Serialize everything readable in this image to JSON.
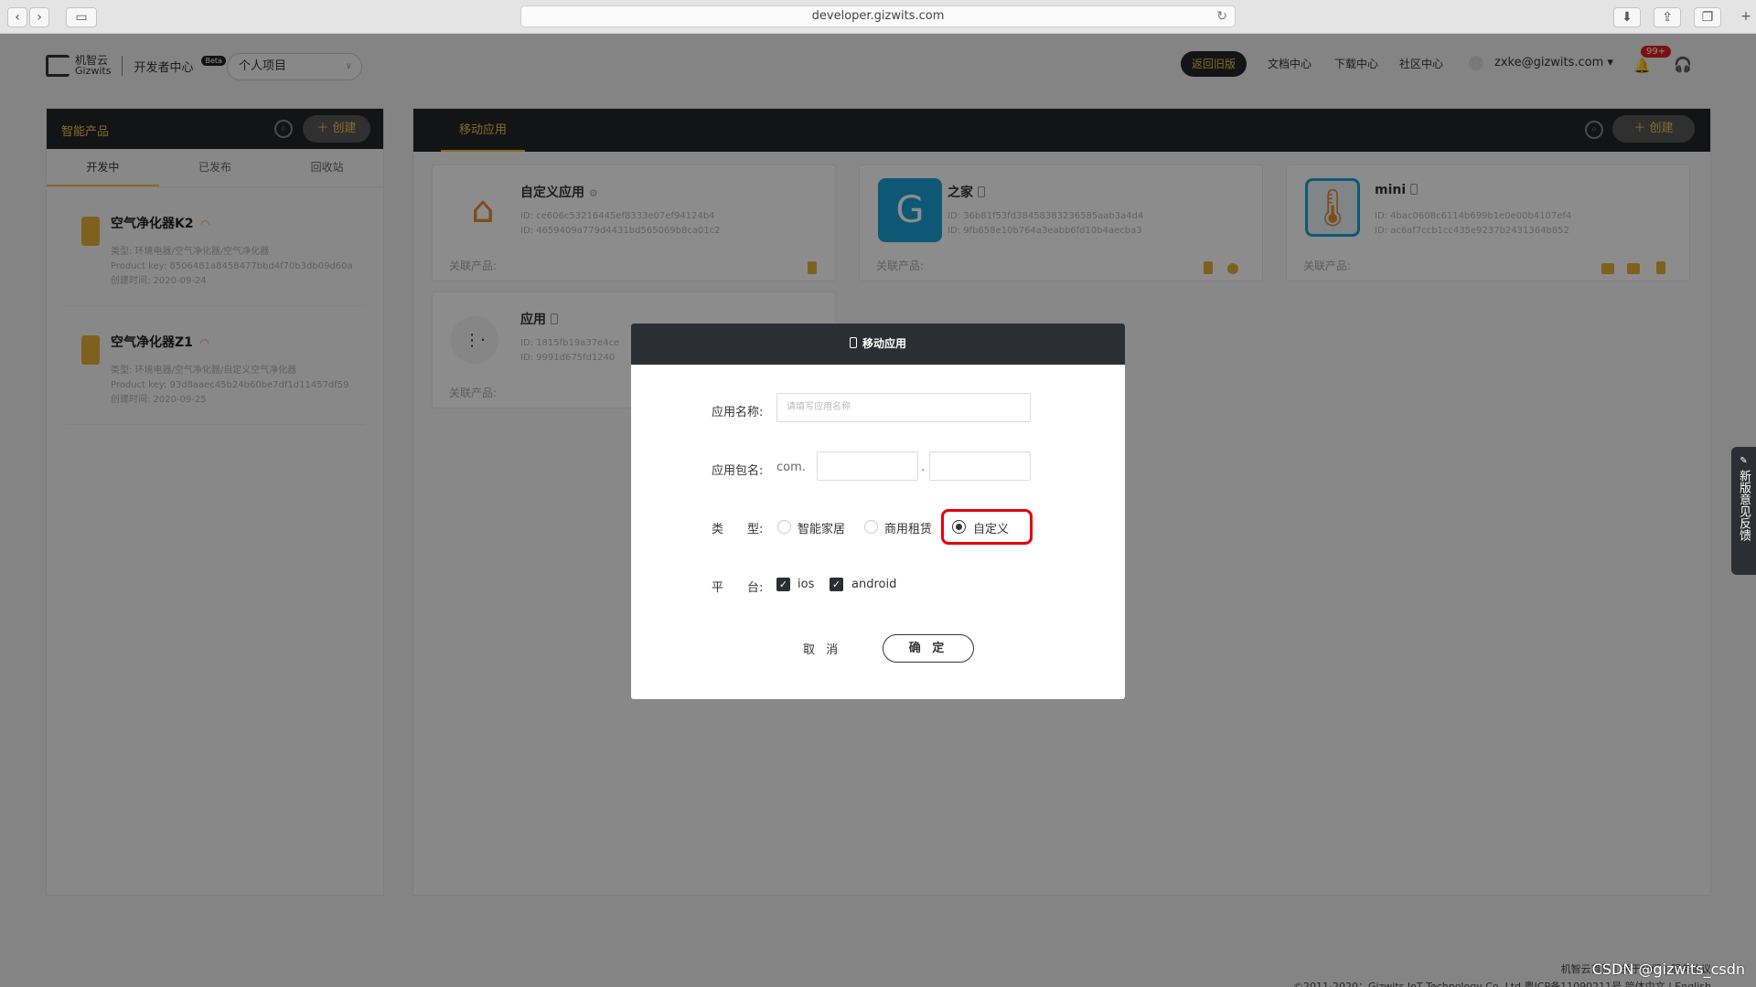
{
  "browser": {
    "url": "developer.gizwits.com"
  },
  "header": {
    "logo_cn": "机智云",
    "logo_en": "Gizwits",
    "dev_center": "开发者中心",
    "beta": "Beta",
    "project_select": "个人项目",
    "old_version": "返回旧版",
    "nav": [
      "文档中心",
      "下载中心",
      "社区中心"
    ],
    "user": "zxke@gizwits.com ▾",
    "notifications": "99+"
  },
  "left_panel": {
    "title": "智能产品",
    "create": "＋ 创建",
    "tabs": [
      "开发中",
      "已发布",
      "回收站"
    ],
    "products": [
      {
        "name": "空气净化器K2",
        "type": "类型: 环境电器/空气净化器/空气净化器",
        "key": "Product key: 8506481a8458477bbd4f70b3db09d60a",
        "created": "创建时间: 2020-09-24"
      },
      {
        "name": "空气净化器Z1",
        "type": "类型: 环境电器/空气净化器/自定义空气净化器",
        "key": "Product key: 93d8aaec45b24b60be7df1d11457df59",
        "created": "创建时间: 2020-09-25"
      }
    ]
  },
  "right_panel": {
    "tab": "移动应用",
    "create": "＋ 创建",
    "related_label": "关联产品:",
    "cards": [
      {
        "title": "自定义应用",
        "id1": "ID:  ce606c53216445ef8333e07ef94124b4",
        "id2": "ID:  4659409a779d4431bd565069b8ca01c2"
      },
      {
        "title": "之家",
        "id1": "ID:  36b81f53fd38458383236585aab3a4d4",
        "id2": "ID:  9fb658e10b764a3eabb6fd10b4aecba3"
      },
      {
        "title": "mini",
        "id1": "ID:  4bac0608c6114b699b1e0e00b4107ef4",
        "id2": "ID:  ac6af7ccb1cc435e9237b2431364b852"
      },
      {
        "title": "应用",
        "id1": "ID:  1815fb19a37e4ce",
        "id2": "ID:  9991d675fd1240"
      }
    ]
  },
  "modal": {
    "title": "移动应用",
    "name_label": "应用名称:",
    "name_placeholder": "请填写应用名称",
    "pkg_label": "应用包名:",
    "pkg_prefix": "com.",
    "pkg_dot": ".",
    "type_label": "类　　型:",
    "types": [
      "智能家居",
      "商用租赁",
      "自定义"
    ],
    "selected_type": "自定义",
    "platform_label": "平　　台:",
    "platforms": [
      "ios",
      "android"
    ],
    "cancel": "取 消",
    "ok": "确 定"
  },
  "feedback": "新版意见反馈",
  "footer": {
    "links": "机智云首页 | 关于我们 | 服务协议",
    "copyright": "©2011-2020：Gizwits IoT Technology Co, Ltd 粤ICP备11090211号 简体中文 | English",
    "watermark": "CSDN @gizwits_csdn"
  },
  "colors": {
    "accent": "#f5c341",
    "dark": "#232629",
    "highlight": "#e3000f"
  }
}
